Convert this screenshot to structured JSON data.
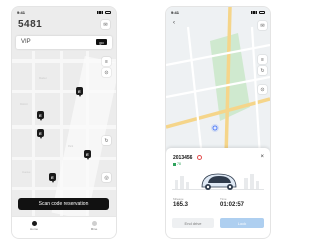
{
  "left": {
    "status": {
      "time": "9:41"
    },
    "brand": "5481",
    "vip": {
      "label": "VIP",
      "button": "go"
    },
    "pins": [
      "E",
      "E",
      "E",
      "E",
      "E"
    ],
    "scan_button": "Scan code reservation",
    "tabs": [
      {
        "label": "Home",
        "color": "#1a1a1a"
      },
      {
        "label": "Mine",
        "color": "#cfcfcf"
      }
    ]
  },
  "right": {
    "status": {
      "time": "9:41"
    },
    "car": {
      "id": "2013456",
      "battery": "78",
      "left_stat": {
        "label": "Mileage",
        "value": "165.3"
      },
      "right_stat": {
        "label": "Time",
        "value": "01:02:57"
      },
      "end_button": "End drive",
      "lock_button": "Lock"
    },
    "accent": "#aecff0"
  }
}
